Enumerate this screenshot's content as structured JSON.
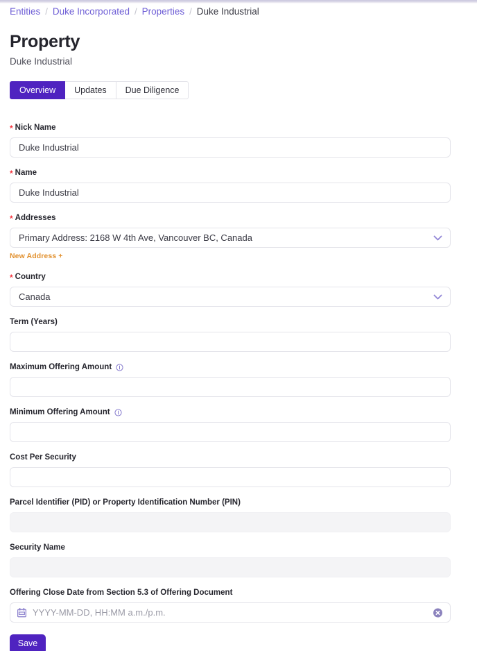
{
  "breadcrumb": {
    "items": [
      {
        "label": "Entities",
        "current": false
      },
      {
        "label": "Duke Incorporated",
        "current": false
      },
      {
        "label": "Properties",
        "current": false
      },
      {
        "label": "Duke Industrial",
        "current": true
      }
    ],
    "separator": "/"
  },
  "header": {
    "title": "Property",
    "subtitle": "Duke Industrial"
  },
  "tabs": [
    {
      "label": "Overview",
      "active": true
    },
    {
      "label": "Updates",
      "active": false
    },
    {
      "label": "Due Diligence",
      "active": false
    }
  ],
  "form": {
    "fields": [
      {
        "label": "Nick Name",
        "required": true,
        "type": "text",
        "value": "Duke Industrial",
        "disabled": false,
        "info": false
      },
      {
        "label": "Name",
        "required": true,
        "type": "text",
        "value": "Duke Industrial",
        "disabled": false,
        "info": false
      },
      {
        "label": "Addresses",
        "required": true,
        "type": "select",
        "value": "Primary Address: 2168 W 4th Ave, Vancouver BC, Canada",
        "disabled": false,
        "info": false,
        "helper_link": "New Address +"
      },
      {
        "label": "Country",
        "required": true,
        "type": "select",
        "value": "Canada",
        "disabled": false,
        "info": false
      },
      {
        "label": "Term (Years)",
        "required": false,
        "type": "text",
        "value": "",
        "disabled": false,
        "info": false
      },
      {
        "label": "Maximum Offering Amount",
        "required": false,
        "type": "text",
        "value": "",
        "disabled": false,
        "info": true
      },
      {
        "label": "Minimum Offering Amount",
        "required": false,
        "type": "text",
        "value": "",
        "disabled": false,
        "info": true
      },
      {
        "label": "Cost Per Security",
        "required": false,
        "type": "text",
        "value": "",
        "disabled": false,
        "info": false
      },
      {
        "label": "Parcel Identifier (PID) or Property Identification Number (PIN)",
        "required": false,
        "type": "text",
        "value": "",
        "disabled": true,
        "info": false
      },
      {
        "label": "Security Name",
        "required": false,
        "type": "text",
        "value": "",
        "disabled": true,
        "info": false
      },
      {
        "label": "Offering Close Date from Section 5.3 of Offering Document",
        "required": false,
        "type": "datetime",
        "value": "",
        "placeholder": "YYYY-MM-DD, HH:MM a.m./p.m.",
        "disabled": false,
        "info": false
      }
    ],
    "save_label": "Save"
  },
  "colors": {
    "accent": "#4F23C0",
    "breadcrumb_link": "#6F5FD6",
    "required_star": "#F4333D",
    "helper_link": "#E2912F",
    "icon_purple": "#8E83CE",
    "disabled_field": "#F4F4F6"
  }
}
